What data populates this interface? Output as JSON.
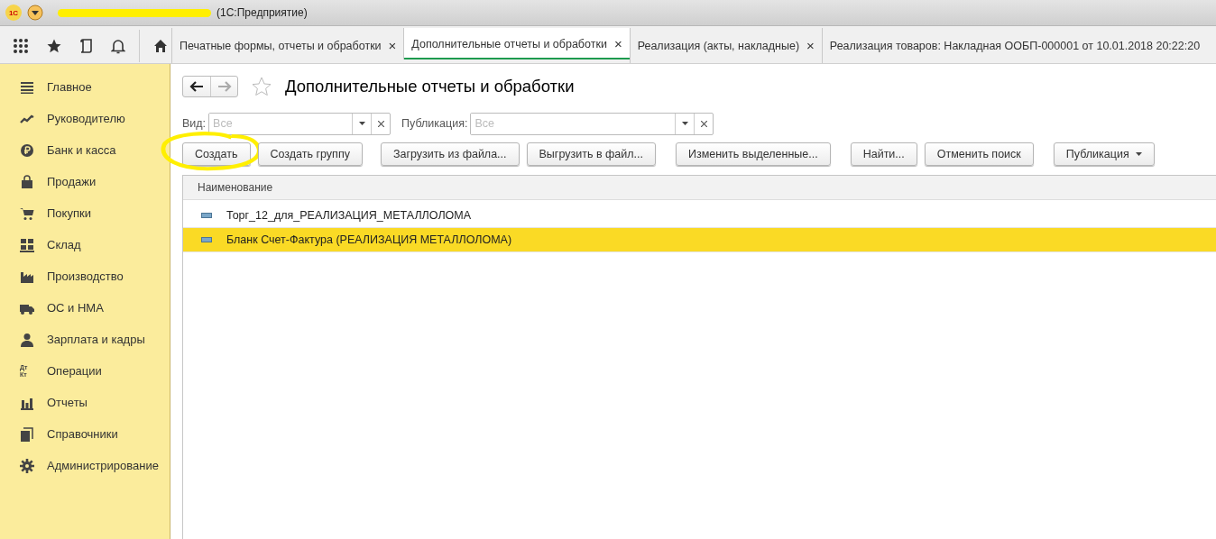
{
  "window": {
    "logo": "1С",
    "title": "(1С:Предприятие)"
  },
  "toolbar_tabs": [
    {
      "label": "Печатные формы, отчеты и обработки",
      "close": "×",
      "selected": false
    },
    {
      "label": "Дополнительные отчеты и обработки",
      "close": "×",
      "selected": true
    },
    {
      "label": "Реализация (акты, накладные)",
      "close": "×",
      "selected": false
    },
    {
      "label": "Реализация товаров: Накладная ООБП-000001 от 10.01.2018 20:22:20",
      "selected": false
    }
  ],
  "sidebar": {
    "items": [
      {
        "label": "Главное"
      },
      {
        "label": "Руководителю"
      },
      {
        "label": "Банк и касса"
      },
      {
        "label": "Продажи"
      },
      {
        "label": "Покупки"
      },
      {
        "label": "Склад"
      },
      {
        "label": "Производство"
      },
      {
        "label": "ОС и НМА"
      },
      {
        "label": "Зарплата и кадры"
      },
      {
        "label": "Операции",
        "icon_text": "Дт Кт"
      },
      {
        "label": "Отчеты"
      },
      {
        "label": "Справочники"
      },
      {
        "label": "Администрирование"
      }
    ]
  },
  "page": {
    "title": "Дополнительные отчеты и обработки",
    "filters": [
      {
        "label": "Вид:",
        "placeholder": "Все"
      },
      {
        "label": "Публикация:",
        "placeholder": "Все"
      }
    ],
    "buttons": [
      {
        "label": "Создать",
        "highlighted": true
      },
      {
        "label": "Создать группу",
        "highlighted": false
      },
      {
        "label": "Загрузить из файла...",
        "highlighted": false
      },
      {
        "label": "Выгрузить в файл...",
        "highlighted": false
      },
      {
        "label": "Изменить выделенные...",
        "highlighted": false
      },
      {
        "label": "Найти...",
        "highlighted": false
      },
      {
        "label": "Отменить поиск",
        "highlighted": false
      },
      {
        "label": "Публикация",
        "highlighted": false,
        "dropdown": true
      }
    ],
    "table": {
      "columns": [
        "Наименование"
      ],
      "rows": [
        {
          "name": "Торг_12_для_РЕАЛИЗАЦИЯ_МЕТАЛЛОЛОМА",
          "selected": false
        },
        {
          "name": "Бланк Счет-Фактура (РЕАЛИЗАЦИЯ МЕТАЛЛОЛОМА)",
          "selected": true
        }
      ]
    }
  }
}
